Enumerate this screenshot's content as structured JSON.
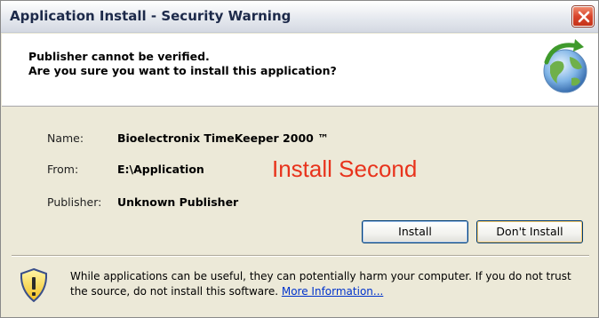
{
  "window": {
    "title": "Application Install - Security Warning",
    "close_icon": "close-icon"
  },
  "header": {
    "line1": "Publisher cannot be verified.",
    "line2": "Are you sure you want to install this application?",
    "icon": "globe-arrow-icon"
  },
  "details": {
    "name_label": "Name:",
    "name_value": "Bioelectronix TimeKeeper 2000 ™",
    "from_label": "From:",
    "from_value": "E:\\Application",
    "publisher_label": "Publisher:",
    "publisher_value": "Unknown Publisher"
  },
  "annotation": {
    "text": "Install Second",
    "color": "#e8331c"
  },
  "buttons": {
    "install": "Install",
    "dont_install": "Don't Install"
  },
  "warning": {
    "icon": "shield-warning-icon",
    "text": "While applications can be useful, they can potentially harm your computer. If you do not trust the source, do not install this software.",
    "link": "More Information..."
  }
}
